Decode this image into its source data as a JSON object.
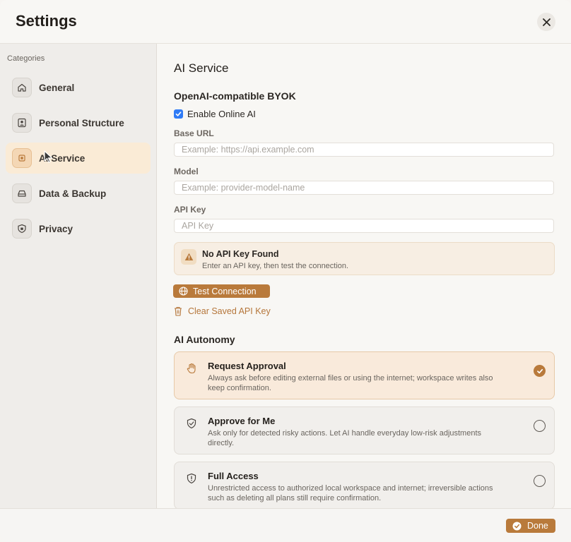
{
  "window": {
    "title": "Settings"
  },
  "sidebar": {
    "categories_label": "Categories",
    "items": [
      {
        "label": "General",
        "icon": "home-icon",
        "active": false
      },
      {
        "label": "Personal Structure",
        "icon": "person-icon",
        "active": false
      },
      {
        "label": "AI Service",
        "icon": "chip-icon",
        "active": true
      },
      {
        "label": "Data & Backup",
        "icon": "drive-icon",
        "active": false
      },
      {
        "label": "Privacy",
        "icon": "shield-icon",
        "active": false
      }
    ]
  },
  "main": {
    "section_title": "AI Service",
    "byok": {
      "title": "OpenAI-compatible BYOK",
      "enable_label": "Enable Online AI",
      "enable_checked": true,
      "base_url": {
        "label": "Base URL",
        "value": "",
        "placeholder": "Example: https://api.example.com"
      },
      "model": {
        "label": "Model",
        "value": "",
        "placeholder": "Example: provider-model-name"
      },
      "api_key": {
        "label": "API Key",
        "value": "",
        "placeholder": "API Key"
      }
    },
    "warning": {
      "title": "No API Key Found",
      "description": "Enter an API key, then test the connection."
    },
    "test_button": "Test Connection",
    "clear_link": "Clear Saved API Key",
    "autonomy": {
      "title": "AI Autonomy",
      "options": [
        {
          "title": "Request Approval",
          "description": "Always ask before editing external files or using the internet; workspace writes also keep confirmation.",
          "icon": "hand-icon",
          "selected": true
        },
        {
          "title": "Approve for Me",
          "description": "Ask only for detected risky actions. Let AI handle everyday low-risk adjustments directly.",
          "icon": "shield-check-icon",
          "selected": false
        },
        {
          "title": "Full Access",
          "description": "Unrestricted access to authorized local workspace and internet; irreversible actions such as deleting all plans still require confirmation.",
          "icon": "shield-alert-icon",
          "selected": false
        }
      ]
    }
  },
  "footer": {
    "done_label": "Done"
  },
  "colors": {
    "accent": "#b97a3b",
    "active_nav_bg": "#faebd6",
    "checkbox": "#2f7bf6"
  }
}
